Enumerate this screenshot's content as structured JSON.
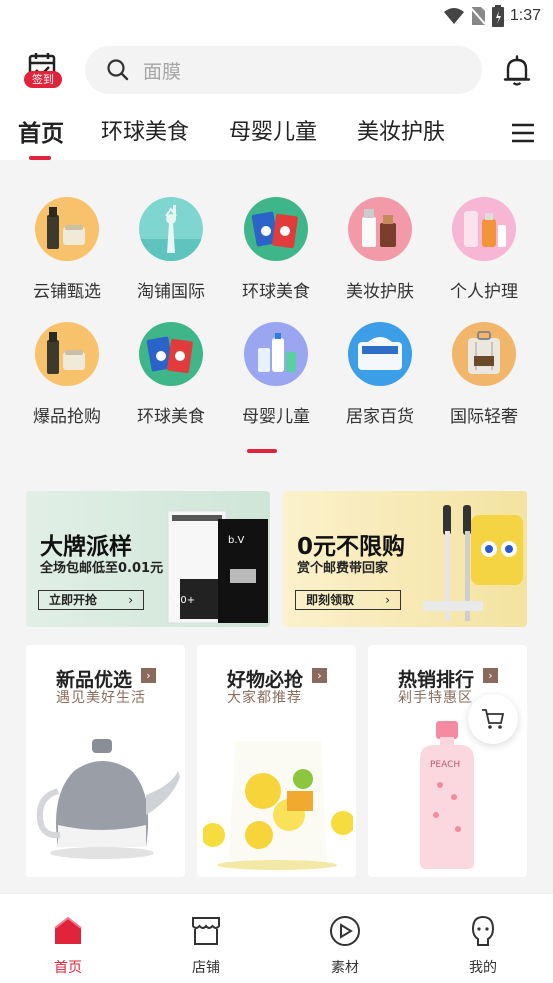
{
  "status_bar": {
    "time": "1:37"
  },
  "header": {
    "signin_label": "签到",
    "search_placeholder": "面膜"
  },
  "tabs": [
    {
      "label": "首页",
      "active": true
    },
    {
      "label": "环球美食"
    },
    {
      "label": "母婴儿童"
    },
    {
      "label": "美妆护肤"
    }
  ],
  "categories": [
    {
      "label": "云铺甄选",
      "icon": "skincare-bottles-icon"
    },
    {
      "label": "淘铺国际",
      "icon": "statue-of-liberty-icon"
    },
    {
      "label": "环球美食",
      "icon": "snack-packs-icon"
    },
    {
      "label": "美妆护肤",
      "icon": "cosmetics-icon"
    },
    {
      "label": "个人护理",
      "icon": "lotion-bottles-icon"
    },
    {
      "label": "爆品抢购",
      "icon": "skincare-bottles-icon"
    },
    {
      "label": "环球美食",
      "icon": "snack-packs-icon"
    },
    {
      "label": "母婴儿童",
      "icon": "baby-care-icon"
    },
    {
      "label": "居家百货",
      "icon": "tissue-pack-icon"
    },
    {
      "label": "国际轻奢",
      "icon": "luggage-icon"
    }
  ],
  "banners": [
    {
      "title": "大牌派样",
      "subtitle": "全场包邮低至0.01元",
      "button": "立即开抢",
      "bg": "#dcebe2"
    },
    {
      "title": "0元不限购",
      "subtitle": "赏个邮费带回家",
      "button": "即刻领取",
      "bg": "#f6ecbb"
    }
  ],
  "cards": [
    {
      "title": "新品优选",
      "subtitle": "遇见美好生活",
      "image": "teapot-icon"
    },
    {
      "title": "好物必抢",
      "subtitle": "大家都推荐",
      "image": "lemon-snack-icon"
    },
    {
      "title": "热销排行",
      "subtitle": "剁手特惠区",
      "image": "peach-bottle-icon"
    }
  ],
  "bottom_nav": [
    {
      "label": "首页",
      "icon": "home-icon",
      "active": true
    },
    {
      "label": "店铺",
      "icon": "store-icon"
    },
    {
      "label": "素材",
      "icon": "play-icon"
    },
    {
      "label": "我的",
      "icon": "profile-icon"
    }
  ],
  "colors": {
    "accent": "#e0243c",
    "card_subtitle": "#8c6d5d"
  }
}
